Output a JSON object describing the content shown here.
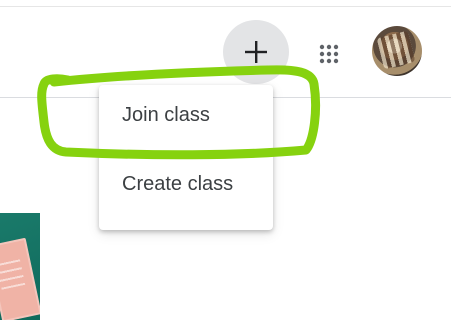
{
  "header": {
    "add_button": {
      "icon": "plus-icon",
      "symbol": "+"
    },
    "apps_button": {
      "icon": "apps-grid-icon"
    },
    "avatar": {
      "icon": "account-avatar-image"
    }
  },
  "add_menu": {
    "items": [
      {
        "label": "Join class",
        "highlighted": true
      },
      {
        "label": "Create class",
        "highlighted": false
      }
    ]
  },
  "colors": {
    "highlight_marker": "#86d20f",
    "add_button_bg": "#e3e4e6",
    "menu_text": "#3c4043",
    "course_card_green": "#0f6a5c"
  }
}
